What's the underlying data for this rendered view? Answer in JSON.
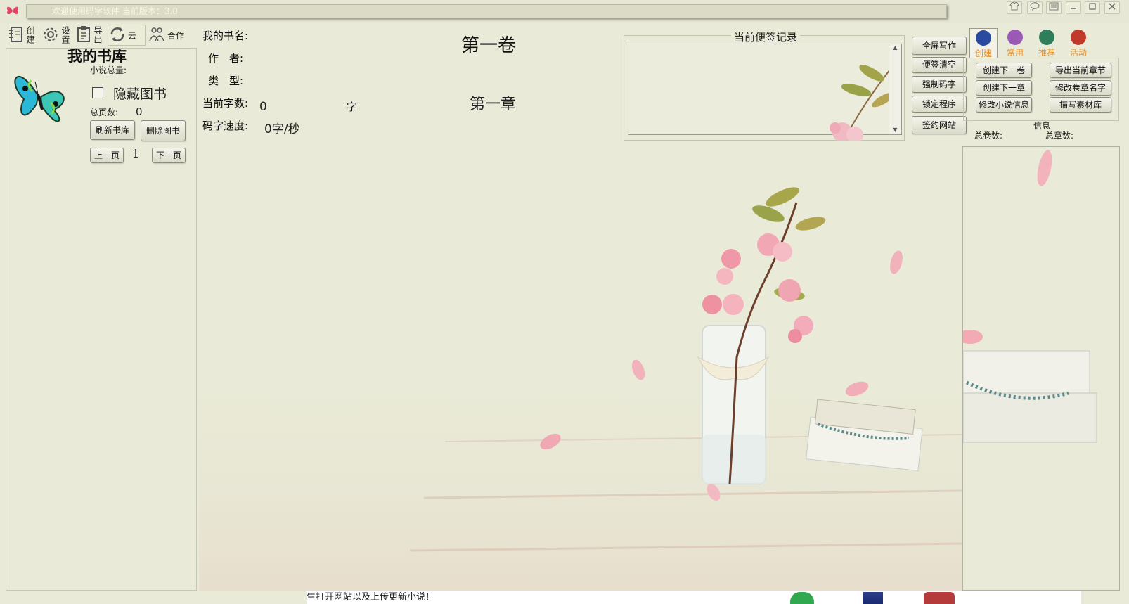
{
  "window": {
    "title": "欢迎使用码字软件  当前版本：3.0",
    "controls": [
      "skin",
      "feedback",
      "menu",
      "minimize",
      "maximize",
      "close"
    ]
  },
  "toolbar": {
    "create_label": "创建",
    "settings_label": "设置",
    "export_label": "导出",
    "cloud_label": "云",
    "cooperate_label": "合作"
  },
  "library": {
    "title": "我的书库",
    "novel_total_label": "小说总量:",
    "hide_books_label": "隐藏图书",
    "total_pages_label": "总页数:",
    "total_pages_value": "0",
    "refresh_button": "刷新书库",
    "delete_button": "删除图书",
    "prev_page_button": "上一页",
    "page_number": "1",
    "next_page_button": "下一页"
  },
  "book_info": {
    "name_label": "我的书名:",
    "author_label": "作　者:",
    "type_label": "类　型:",
    "word_count_label": "当前字数:",
    "word_count_value": "0",
    "word_unit": "字",
    "speed_label": "码字速度:",
    "speed_value": "0字/秒",
    "volume_title": "第一卷",
    "chapter_title": "第一章"
  },
  "notes": {
    "legend": "当前便签记录",
    "content": ""
  },
  "actions": {
    "fullscreen": "全屏写作",
    "clear_notes": "便签清空",
    "force_typing": "强制码字",
    "lock_program": "锁定程序",
    "sign_site": "签约网站"
  },
  "tabs": [
    {
      "label": "创建",
      "active": true,
      "color": "#2a4aa0"
    },
    {
      "label": "常用",
      "active": false,
      "color": "#9b59b6"
    },
    {
      "label": "推荐",
      "active": false,
      "color": "#2e7d5b"
    },
    {
      "label": "活动",
      "active": false,
      "color": "#c0392b"
    }
  ],
  "create_panel": {
    "create_next_volume": "创建下一卷",
    "export_current_chapter": "导出当前章节",
    "create_next_chapter": "创建下一章",
    "rename_volume_chapter": "修改卷章名字",
    "edit_novel_info": "修改小说信息",
    "write_material": "描写素材库"
  },
  "info_group": {
    "title": "信息",
    "total_volumes_label": "总卷数:",
    "total_chapters_label": "总章数:"
  },
  "status": {
    "message": "生打开网站以及上传更新小说！"
  }
}
